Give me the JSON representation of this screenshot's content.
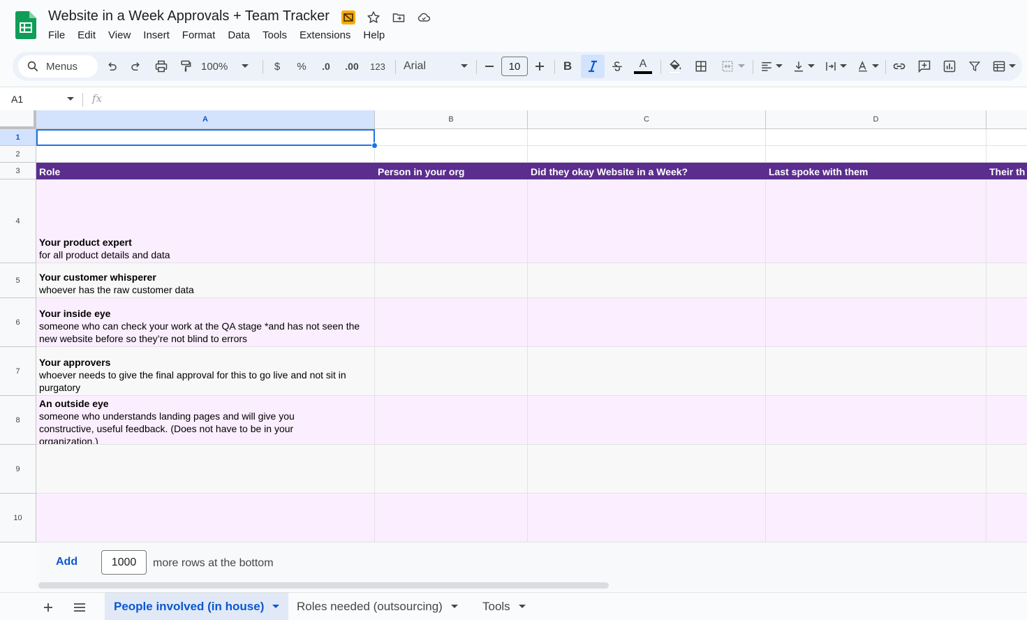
{
  "app": {
    "title": "Website in a Week Approvals + Team Tracker",
    "menus": [
      "File",
      "Edit",
      "View",
      "Insert",
      "Format",
      "Data",
      "Tools",
      "Extensions",
      "Help"
    ]
  },
  "toolbar": {
    "search_label": "Menus",
    "zoom": "100%",
    "currency": "$",
    "percent": "%",
    "dec_decrease": ".0",
    "dec_increase": ".00",
    "number_format": "123",
    "font": "Arial",
    "font_size": "10",
    "bold": "B",
    "text_color_letter": "A",
    "accent_color": "#0b57d0",
    "italic_active": true
  },
  "formula_bar": {
    "name_box": "A1",
    "fx": "fx",
    "value": ""
  },
  "sheet": {
    "columns": [
      "A",
      "B",
      "C",
      "D"
    ],
    "selected_column": "A",
    "selected_cell": "A1",
    "rows": [
      "1",
      "2",
      "3",
      "4",
      "5",
      "6",
      "7",
      "8",
      "9",
      "10"
    ],
    "header_fill": "#5b2d8e",
    "band_fill": "#fbeefe",
    "header_row": {
      "a": "Role",
      "b": "Person in your org",
      "c": "Did they okay Website in a Week?",
      "d": "Last spoke with them",
      "e": "Their th"
    },
    "roles": [
      {
        "title": "Your product expert",
        "desc": "for all product details and data"
      },
      {
        "title": "Your customer whisperer",
        "desc": "whoever has the raw customer data"
      },
      {
        "title": "Your inside eye",
        "desc": "someone who can check your work at the QA stage *and has not seen the new website before so they’re not blind to errors"
      },
      {
        "title": "Your approvers",
        "desc": "whoever needs to give the final approval for this to go live and not sit in purgatory"
      },
      {
        "title": "An outside eye",
        "desc": "someone who understands landing pages and will give you constructive, useful feedback. (Does not have to be in your organization.)"
      }
    ]
  },
  "add_rows": {
    "button": "Add",
    "count": "1000",
    "suffix": "more rows at the bottom"
  },
  "tabs": [
    {
      "label": "People involved (in house)",
      "active": true
    },
    {
      "label": "Roles needed (outsourcing)",
      "active": false
    },
    {
      "label": "Tools",
      "active": false
    }
  ]
}
